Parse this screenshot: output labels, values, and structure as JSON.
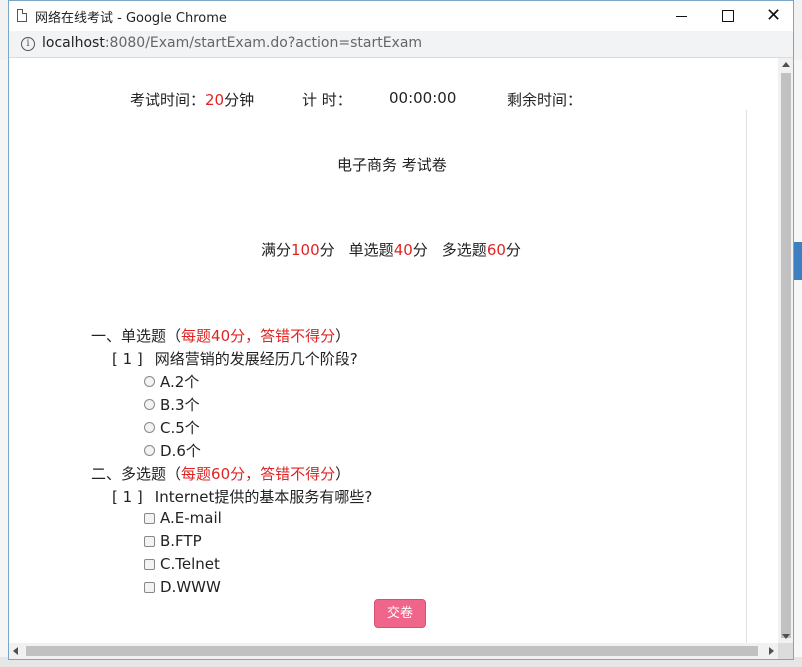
{
  "browser": {
    "title": "网络在线考试 - Google Chrome",
    "url_host": "localhost",
    "url_rest": ":8080/Exam/startExam.do?action=startExam"
  },
  "exam": {
    "time_label": "考试时间：",
    "time_value": "20",
    "time_unit": "分钟",
    "timer_label": "计 时：",
    "timer_value": "00:00:00",
    "remaining_label": "剩余时间：",
    "paper_title": "电子商务 考试卷",
    "score_full_label": "满分",
    "score_full_value": "100",
    "score_full_unit": "分",
    "score_single_label": "单选题",
    "score_single_value": "40",
    "score_single_unit": "分",
    "score_multi_label": "多选题",
    "score_multi_value": "60",
    "score_multi_unit": "分"
  },
  "sections": [
    {
      "heading": "一、单选题",
      "note_open": "（",
      "note": "每题40分，答错不得分",
      "note_close": "）",
      "question_no": "[ 1 ]",
      "question": "网络营销的发展经历几个阶段?",
      "options": [
        "A.2个",
        "B.3个",
        "C.5个",
        "D.6个"
      ]
    },
    {
      "heading": "二、多选题",
      "note_open": "（",
      "note": "每题60分，答错不得分",
      "note_close": "）",
      "question_no": "[ 1 ]",
      "question": "Internet提供的基本服务有哪些?",
      "options": [
        "A.E-mail",
        "B.FTP",
        "C.Telnet",
        "D.WWW"
      ]
    }
  ],
  "submit_label": "交卷",
  "colors": {
    "accent_red": "#e02424",
    "submit_pink": "#f0668a"
  }
}
